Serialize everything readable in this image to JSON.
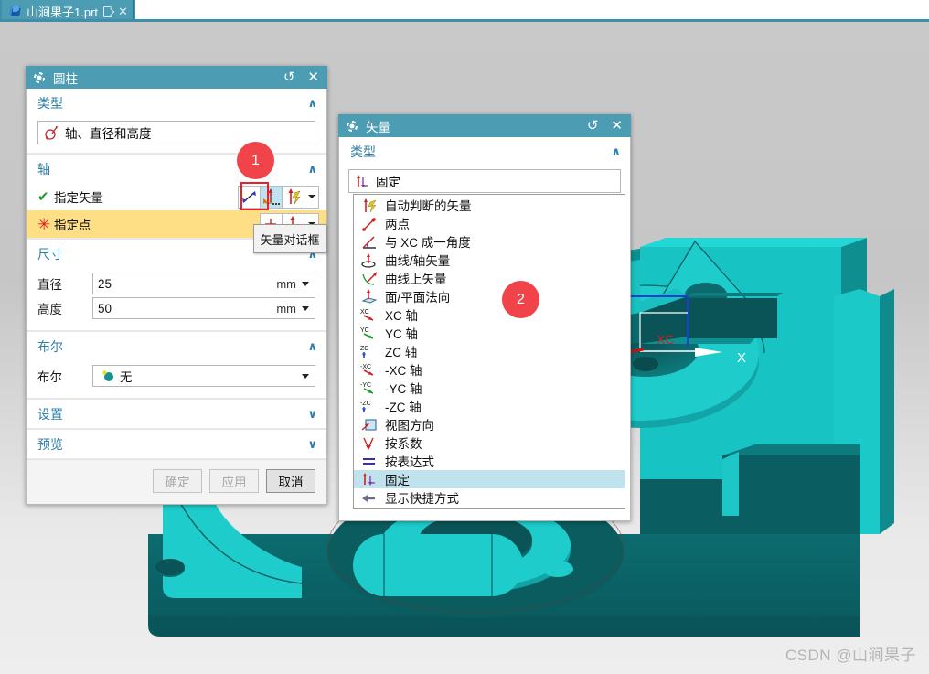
{
  "app": {
    "tab": {
      "filename": "山涧果子1.prt",
      "icon": "nx-part-icon",
      "save_icon": "save-icon",
      "close_label": "✕"
    }
  },
  "watermark": "CSDN @山涧果子",
  "cylinder_dialog": {
    "title": "圆柱",
    "title_icon": "gear-icon",
    "reset_label": "↺",
    "close_label": "✕",
    "sections": {
      "type": {
        "header": "类型",
        "chevron": "∧",
        "selected": "轴、直径和高度",
        "icon": "axis-diameter-height-icon"
      },
      "axis": {
        "header": "轴",
        "chevron": "∧",
        "rows": [
          {
            "mark": "✔",
            "label": "指定矢量",
            "state": "ok"
          },
          {
            "mark": "✳",
            "label": "指定点",
            "state": "required"
          }
        ],
        "vector_buttons": [
          {
            "name": "reverse-direction-button",
            "icon": "double-arrow-icon",
            "active": false
          },
          {
            "name": "vector-dialog-button",
            "icon": "vector-constructor-icon",
            "active": true
          },
          {
            "name": "inferred-vector-button",
            "icon": "inferred-vector-icon",
            "active": false
          },
          {
            "name": "vector-dropdown-button",
            "icon": "chevron-down-icon",
            "active": false
          }
        ],
        "point_buttons": [
          {
            "name": "point-dialog-button",
            "icon": "point-constructor-icon",
            "active": false
          },
          {
            "name": "point-type-button",
            "icon": "point-type-icon",
            "active": false
          },
          {
            "name": "point-dropdown-button",
            "icon": "chevron-down-icon",
            "active": false
          }
        ]
      },
      "dimensions": {
        "header": "尺寸",
        "chevron": "∧",
        "fields": [
          {
            "label": "直径",
            "value": "25",
            "unit": "mm"
          },
          {
            "label": "高度",
            "value": "50",
            "unit": "mm"
          }
        ]
      },
      "boolean": {
        "header": "布尔",
        "chevron": "∧",
        "field": {
          "label": "布尔",
          "value": "无",
          "icon": "boolean-none-icon"
        }
      },
      "settings": {
        "header": "设置",
        "chevron": "∨"
      },
      "preview": {
        "header": "预览",
        "chevron": "∨"
      }
    },
    "footer": {
      "ok": "确定",
      "apply": "应用",
      "cancel": "取消"
    }
  },
  "tooltip": {
    "text": "矢量对话框"
  },
  "vector_dialog": {
    "title": "矢量",
    "title_icon": "gear-icon",
    "reset_label": "↺",
    "close_label": "✕",
    "type_section": {
      "header": "类型",
      "chevron": "∧",
      "selected": "固定",
      "selected_icon": "fixed-vector-icon"
    },
    "options": [
      {
        "label": "自动判断的矢量",
        "icon": "inferred-vector-icon",
        "selected": false
      },
      {
        "label": "两点",
        "icon": "two-points-icon",
        "selected": false
      },
      {
        "label": "与 XC 成一角度",
        "icon": "angle-to-xc-icon",
        "selected": false
      },
      {
        "label": "曲线/轴矢量",
        "icon": "curve-axis-vector-icon",
        "selected": false
      },
      {
        "label": "曲线上矢量",
        "icon": "vector-on-curve-icon",
        "selected": false
      },
      {
        "label": "面/平面法向",
        "icon": "face-plane-normal-icon",
        "selected": false
      },
      {
        "label": "XC 轴",
        "icon": "xc-axis-icon",
        "selected": false
      },
      {
        "label": "YC 轴",
        "icon": "yc-axis-icon",
        "selected": false
      },
      {
        "label": "ZC 轴",
        "icon": "zc-axis-icon",
        "selected": false
      },
      {
        "label": "-XC 轴",
        "icon": "neg-xc-axis-icon",
        "selected": false
      },
      {
        "label": "-YC 轴",
        "icon": "neg-yc-axis-icon",
        "selected": false
      },
      {
        "label": "-ZC 轴",
        "icon": "neg-zc-axis-icon",
        "selected": false
      },
      {
        "label": "视图方向",
        "icon": "view-direction-icon",
        "selected": false
      },
      {
        "label": "按系数",
        "icon": "by-coefficients-icon",
        "selected": false
      },
      {
        "label": "按表达式",
        "icon": "by-expression-icon",
        "selected": false
      },
      {
        "label": "固定",
        "icon": "fixed-vector-icon",
        "selected": true
      },
      {
        "label": "显示快捷方式",
        "icon": "show-shortcuts-icon",
        "selected": false
      }
    ]
  },
  "annotations": [
    {
      "id": "badge-1",
      "label": "1",
      "color": "#f0434a"
    },
    {
      "id": "badge-2",
      "label": "2",
      "color": "#f0434a"
    }
  ],
  "model": {
    "csys_labels": {
      "xc": "XC",
      "x": "X"
    },
    "body_color": "#18c3c3",
    "shadow_color": "#0a5a5c"
  },
  "colors": {
    "accent": "#4c9cb4",
    "section_header": "#2f7fa8",
    "highlight_row": "#ffdf85",
    "list_highlight": "#bfe2ec",
    "badge": "#f0434a",
    "red_box": "#e8222a"
  }
}
